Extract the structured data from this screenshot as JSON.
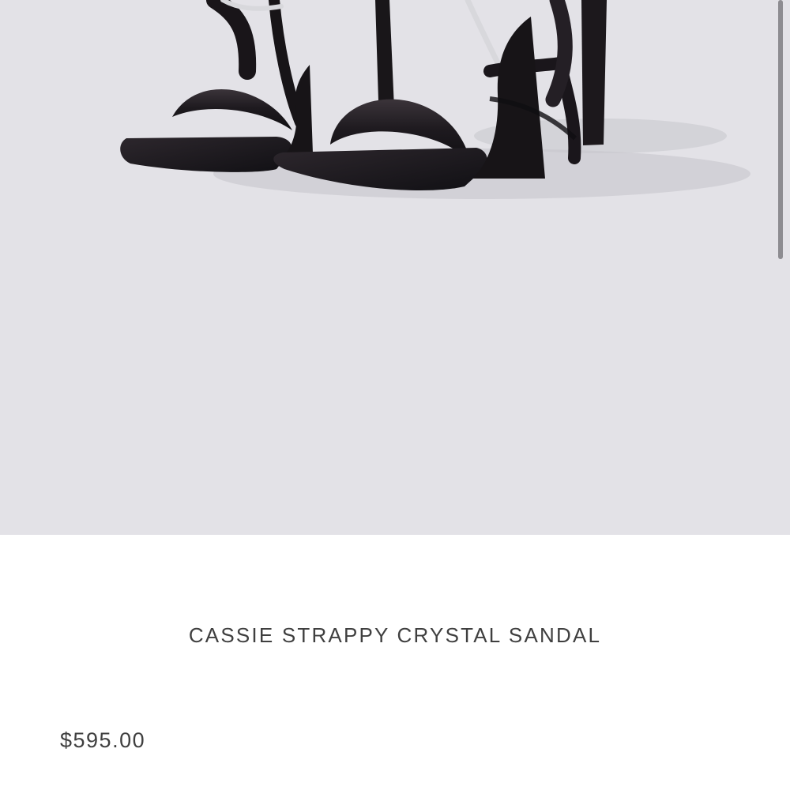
{
  "product": {
    "title": "CASSIE STRAPPY CRYSTAL SANDAL",
    "price": "$595.00",
    "image_background_color": "#e3e2e7"
  },
  "colors": {
    "text": "#3f3f3f",
    "sandal": "#201b20",
    "crystal": "#d7d8db"
  }
}
